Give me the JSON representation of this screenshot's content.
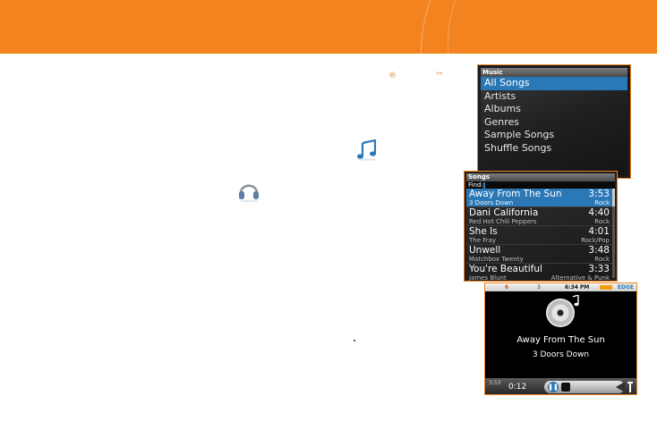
{
  "marks": {
    "registered": "®",
    "trademark": "™"
  },
  "colors": {
    "brand_orange": "#f3831f",
    "selection_blue": "#2b78b7"
  },
  "icons": [
    "music-note-icon",
    "headphones-icon",
    "cd-disc-icon"
  ],
  "music_menu": {
    "title": "Music",
    "items": [
      {
        "label": "All Songs",
        "selected": true
      },
      {
        "label": "Artists"
      },
      {
        "label": "Albums"
      },
      {
        "label": "Genres"
      },
      {
        "label": "Sample Songs"
      },
      {
        "label": "Shuffle Songs"
      }
    ]
  },
  "songs_list": {
    "title": "Songs",
    "find_label": "Find:",
    "rows": [
      {
        "name": "Away From The Sun",
        "duration": "3:53",
        "artist": "3 Doors Down",
        "genre": "Rock",
        "selected": true
      },
      {
        "name": "Dani California",
        "duration": "4:40",
        "artist": "Red Hot Chili Peppers",
        "genre": "Rock"
      },
      {
        "name": "She Is",
        "duration": "4:01",
        "artist": "The Fray",
        "genre": "Rock/Pop"
      },
      {
        "name": "Unwell",
        "duration": "3:48",
        "artist": "Matchbox Twenty",
        "genre": "Rock"
      },
      {
        "name": "You're Beautiful",
        "duration": "3:33",
        "artist": "James Blunt",
        "genre": "Alternative & Punk"
      }
    ]
  },
  "now_playing": {
    "status": {
      "mail_count": "6",
      "msg_count": "3",
      "time": "6:34 PM",
      "network": "EDGE"
    },
    "song": "Away From The Sun",
    "artist": "3 Doors Down",
    "total_time": "3:53",
    "elapsed": "0:12",
    "progress": 0.05
  }
}
